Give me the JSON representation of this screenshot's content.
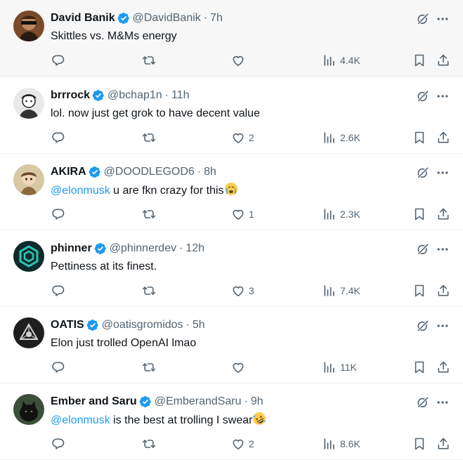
{
  "tweets": [
    {
      "name": "David Banik",
      "handle": "@DavidBanik",
      "time": "7h",
      "text_mention": "",
      "text": "Skittles vs. M&Ms energy",
      "emoji": "",
      "replies": "",
      "reposts": "",
      "likes": "",
      "views": "4.4K",
      "avatar": "avatar-sunglasses"
    },
    {
      "name": "brrrock",
      "handle": "@bchap1n",
      "time": "11h",
      "text_mention": "",
      "text": "lol. now just get grok to have decent value",
      "emoji": "",
      "replies": "",
      "reposts": "",
      "likes": "2",
      "views": "2.6K",
      "avatar": "avatar-sketch"
    },
    {
      "name": "AKIRA",
      "handle": "@DOODLEGOD6",
      "time": "8h",
      "text_mention": "@elonmusk",
      "text": " u are fkn crazy for this",
      "emoji": "loudly-crying-face",
      "replies": "",
      "reposts": "",
      "likes": "1",
      "views": "2.3K",
      "avatar": "avatar-character"
    },
    {
      "name": "phinner",
      "handle": "@phinnerdev",
      "time": "12h",
      "text_mention": "",
      "text": "Pettiness at its finest.",
      "emoji": "",
      "replies": "",
      "reposts": "",
      "likes": "3",
      "views": "7.4K",
      "avatar": "avatar-hex-logo"
    },
    {
      "name": "OATIS",
      "handle": "@oatisgromidos",
      "time": "5h",
      "text_mention": "",
      "text": "Elon just trolled OpenAI lmao",
      "emoji": "",
      "replies": "",
      "reposts": "",
      "likes": "",
      "views": "11K",
      "avatar": "avatar-triangle-logo"
    },
    {
      "name": "Ember and Saru",
      "handle": "@EmberandSaru",
      "time": "9h",
      "text_mention": "@elonmusk",
      "text": " is the best at trolling I swear",
      "emoji": "rolling-laughing-face",
      "replies": "",
      "reposts": "",
      "likes": "2",
      "views": "8.6K",
      "avatar": "avatar-dark-cat"
    }
  ],
  "separator": "·",
  "colors": {
    "accent": "#1d9bf0",
    "text": "#0f1419",
    "muted": "#536471",
    "border": "#eff3f4"
  }
}
